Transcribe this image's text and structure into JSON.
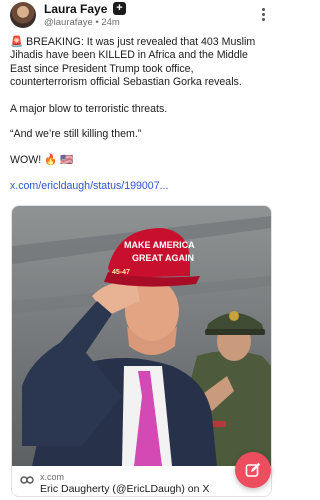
{
  "author": {
    "name": "Laura Faye",
    "badge": "+",
    "handle": "@laurafaye",
    "separator": "•",
    "time": "24m"
  },
  "post": {
    "paragraph1": "🚨 BREAKING: It was just revealed that 403 Muslim Jihadis have been KILLED in Africa and the Middle East since President Trump took office, counterterrorism official Sebastian Gorka reveals.",
    "paragraph2": "A major blow to terroristic threats.",
    "paragraph3": "“And we’re still killing them.”",
    "paragraph4": "WOW! 🔥 🇺🇸",
    "link": "x.com/ericldaugh/status/199007..."
  },
  "card": {
    "domain": "x.com",
    "title": "Eric Daugherty (@EricLDaugh) on X",
    "cap_text_line1": "MAKE AMERICA",
    "cap_text_line2": "GREAT AGAIN",
    "cap_side_text": "45-47"
  },
  "colors": {
    "link": "#2f55c9",
    "fab": "#ec4d5f",
    "cap_red": "#c8102e"
  }
}
